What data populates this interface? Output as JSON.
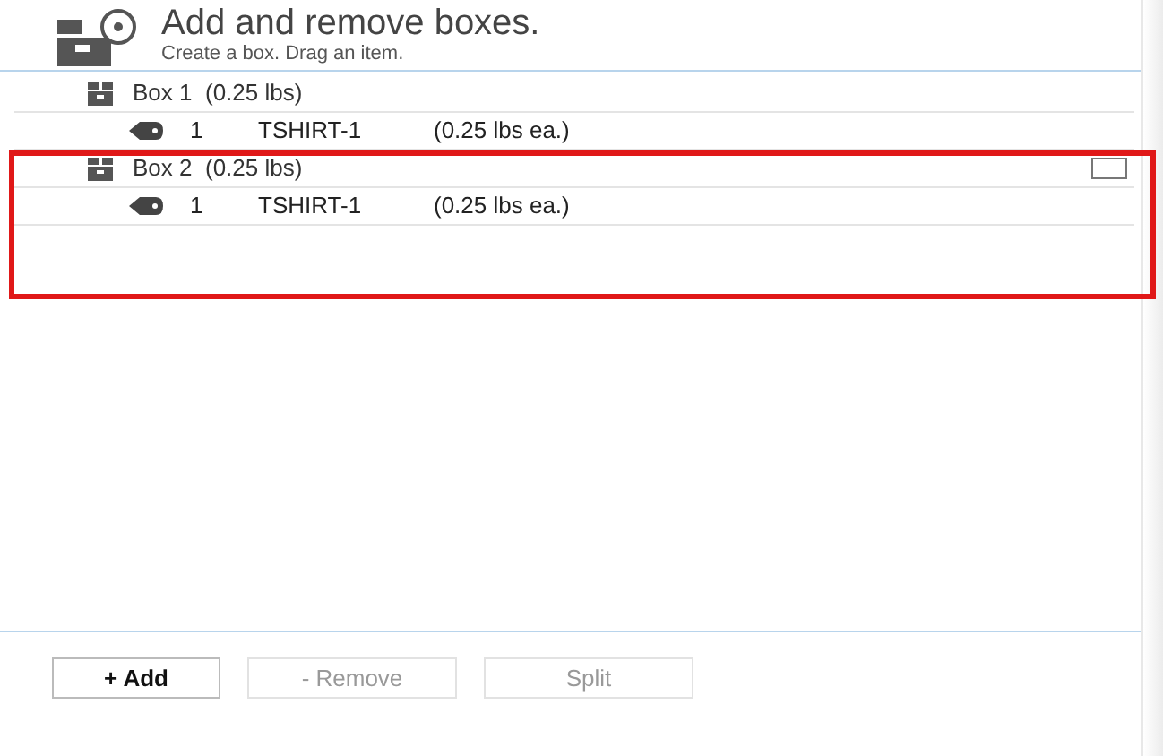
{
  "header": {
    "title": "Add and remove boxes.",
    "subtitle": "Create a box. Drag an item."
  },
  "boxes": [
    {
      "name": "Box 1",
      "weight": "(0.25 lbs)",
      "highlighted": false,
      "items": [
        {
          "qty": "1",
          "sku": "TSHIRT-1",
          "weight": "(0.25 lbs ea.)"
        }
      ]
    },
    {
      "name": "Box 2",
      "weight": "(0.25 lbs)",
      "highlighted": true,
      "checkbox": {
        "checked": false
      },
      "items": [
        {
          "qty": "1",
          "sku": "TSHIRT-1",
          "weight": "(0.25 lbs ea.)"
        }
      ]
    }
  ],
  "buttons": [
    {
      "label": "+ Add",
      "disabled": false
    },
    {
      "label": "- Remove",
      "disabled": true
    },
    {
      "label": "Split",
      "disabled": true
    }
  ]
}
